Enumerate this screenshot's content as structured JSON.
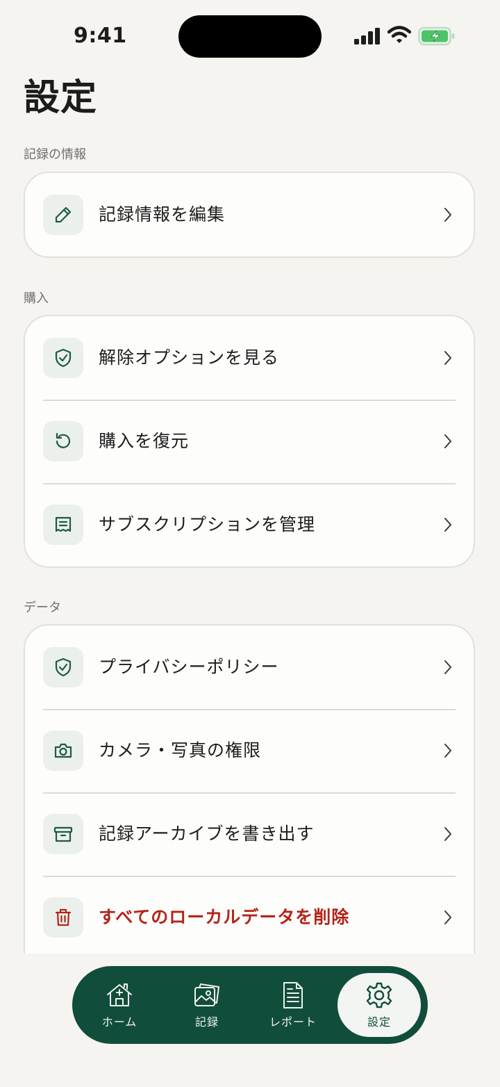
{
  "status_bar": {
    "time": "9:41"
  },
  "page_title": "設定",
  "sections": [
    {
      "label": "記録の情報",
      "rows": [
        {
          "label": "記録情報を編集",
          "icon": "pencil-icon"
        }
      ]
    },
    {
      "label": "購入",
      "rows": [
        {
          "label": "解除オプションを見る",
          "icon": "shield-check-icon"
        },
        {
          "label": "購入を復元",
          "icon": "restore-icon"
        },
        {
          "label": "サブスクリプションを管理",
          "icon": "receipt-icon"
        }
      ]
    },
    {
      "label": "データ",
      "rows": [
        {
          "label": "プライバシーポリシー",
          "icon": "shield-check-icon"
        },
        {
          "label": "カメラ・写真の権限",
          "icon": "camera-icon"
        },
        {
          "label": "記録アーカイブを書き出す",
          "icon": "archive-icon"
        },
        {
          "label": "すべてのローカルデータを削除",
          "icon": "trash-icon"
        }
      ]
    }
  ],
  "tab_bar": {
    "tabs": [
      {
        "label": "ホーム",
        "icon": "home-icon"
      },
      {
        "label": "記録",
        "icon": "photos-icon"
      },
      {
        "label": "レポート",
        "icon": "document-icon"
      },
      {
        "label": "設定",
        "icon": "gear-icon"
      }
    ],
    "active": "設定"
  },
  "colors": {
    "accent": "#114d3b",
    "danger": "#b42318",
    "background": "#f5f4f0",
    "card": "#fdfdfb",
    "battery": "#4cc46b"
  }
}
